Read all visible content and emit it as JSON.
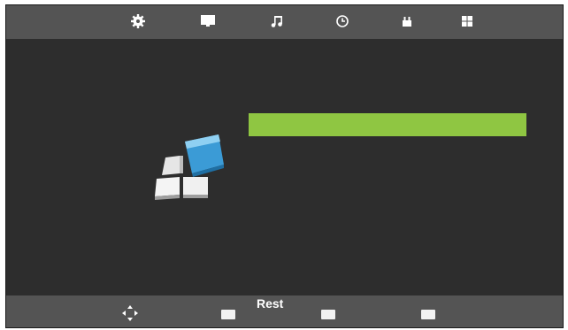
{
  "top_bar": {
    "icons": [
      "gear-icon",
      "monitor-icon",
      "music-note-icon",
      "clock-icon",
      "lock-icon",
      "grid-icon"
    ]
  },
  "main": {
    "progress": {
      "value": 1.0,
      "color": "#8fc642"
    },
    "logo": "windows-blocks-logo"
  },
  "bottom_bar": {
    "label": "Rest",
    "icons": [
      "move-arrows-icon",
      "key-1-icon",
      "key-2-icon",
      "key-3-icon"
    ]
  },
  "colors": {
    "bar_background": "#545454",
    "screen_background": "#2d2d2d",
    "accent": "#8fc642"
  }
}
